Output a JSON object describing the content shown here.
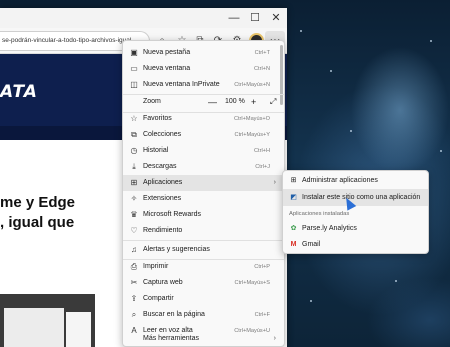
{
  "browser": {
    "address_text": "se-podrán-vincular-a-todo-tipo-archivos-igual-...",
    "window_controls": [
      "minimize",
      "maximize",
      "close"
    ],
    "toolbar_icons": [
      "search-icon",
      "star-icon",
      "collections-icon",
      "refresh-icon",
      "extensions-icon",
      "profile-avatar"
    ],
    "more_label": "···"
  },
  "page": {
    "logo_text": "ATA",
    "headline_1": "me y Edge",
    "headline_2": ", igual que"
  },
  "menu": {
    "items": [
      {
        "icon": "new-tab-icon",
        "label": "Nueva pestaña",
        "shortcut": "Ctrl+T"
      },
      {
        "icon": "new-window-icon",
        "label": "Nueva ventana",
        "shortcut": "Ctrl+N"
      },
      {
        "icon": "inprivate-icon",
        "label": "Nueva ventana InPrivate",
        "shortcut": "Ctrl+Mayús+N"
      },
      {
        "label": "Zoom",
        "zoom_minus": "—",
        "zoom_value": "100 %",
        "zoom_plus": "+",
        "fullscreen": "⤢"
      },
      {
        "icon": "favorites-icon",
        "label": "Favoritos",
        "shortcut": "Ctrl+Mayús+O"
      },
      {
        "icon": "collections-icon",
        "label": "Colecciones",
        "shortcut": "Ctrl+Mayús+Y"
      },
      {
        "icon": "history-icon",
        "label": "Historial",
        "shortcut": "Ctrl+H"
      },
      {
        "icon": "downloads-icon",
        "label": "Descargas",
        "shortcut": "Ctrl+J"
      },
      {
        "icon": "apps-icon",
        "label": "Aplicaciones",
        "arrow": "›"
      },
      {
        "icon": "extensions-icon",
        "label": "Extensiones"
      },
      {
        "icon": "rewards-icon",
        "label": "Microsoft Rewards"
      },
      {
        "icon": "performance-icon",
        "label": "Rendimiento"
      },
      {
        "icon": "alerts-icon",
        "label": "Alertas y sugerencias"
      },
      {
        "icon": "print-icon",
        "label": "Imprimir",
        "shortcut": "Ctrl+P"
      },
      {
        "icon": "web-capture-icon",
        "label": "Captura web",
        "shortcut": "Ctrl+Mayús+S"
      },
      {
        "icon": "share-icon",
        "label": "Compartir"
      },
      {
        "icon": "find-icon",
        "label": "Buscar en la página",
        "shortcut": "Ctrl+F"
      },
      {
        "icon": "read-aloud-icon",
        "label": "Leer en voz alta",
        "shortcut": "Ctrl+Mayús+U"
      },
      {
        "label": "Más herramientas",
        "arrow": "›"
      }
    ]
  },
  "submenu": {
    "items": [
      {
        "icon": "manage-apps-icon",
        "label": "Administrar aplicaciones"
      },
      {
        "icon": "install-site-icon",
        "label": "Instalar este sitio como una aplicación"
      }
    ],
    "installed_heading": "Aplicaciones instaladas",
    "installed": [
      {
        "icon": "parsely-icon",
        "label": "Parse.ly Analytics"
      },
      {
        "icon": "gmail-icon",
        "label": "Gmail"
      }
    ]
  },
  "colors": {
    "menu_bg": "#f9f9f9",
    "highlight": "#e4e4e4",
    "banner": "#0e1f4e",
    "cursor": "#2b6fd6"
  }
}
